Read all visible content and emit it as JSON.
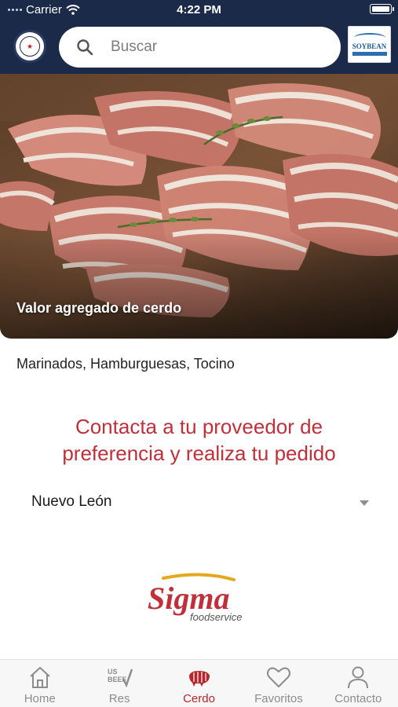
{
  "status_bar": {
    "carrier": "Carrier",
    "time": "4:22 PM"
  },
  "header": {
    "search": {
      "placeholder": "Buscar",
      "value": ""
    },
    "right_logo_text": "SOYBEAN"
  },
  "hero": {
    "caption": "Valor agregado de cerdo"
  },
  "product_list": "Marinados, Hamburguesas, Tocino",
  "cta": {
    "line1": "Contacta a tu proveedor de",
    "line2": "preferencia y realiza tu pedido"
  },
  "state_select": {
    "selected": "Nuevo León"
  },
  "supplier": {
    "name": "Sigma",
    "subtitle": "foodservice"
  },
  "tabs": [
    {
      "label": "Home",
      "icon": "home-icon"
    },
    {
      "label": "Res",
      "icon": "beef-icon"
    },
    {
      "label": "Cerdo",
      "icon": "pork-icon",
      "active": true
    },
    {
      "label": "Favoritos",
      "icon": "heart-icon"
    },
    {
      "label": "Contacto",
      "icon": "person-icon"
    }
  ],
  "colors": {
    "header": "#1c2a4a",
    "accent": "#c0303a",
    "tab_active": "#b5262e",
    "tab_inactive": "#8c8c8c"
  }
}
